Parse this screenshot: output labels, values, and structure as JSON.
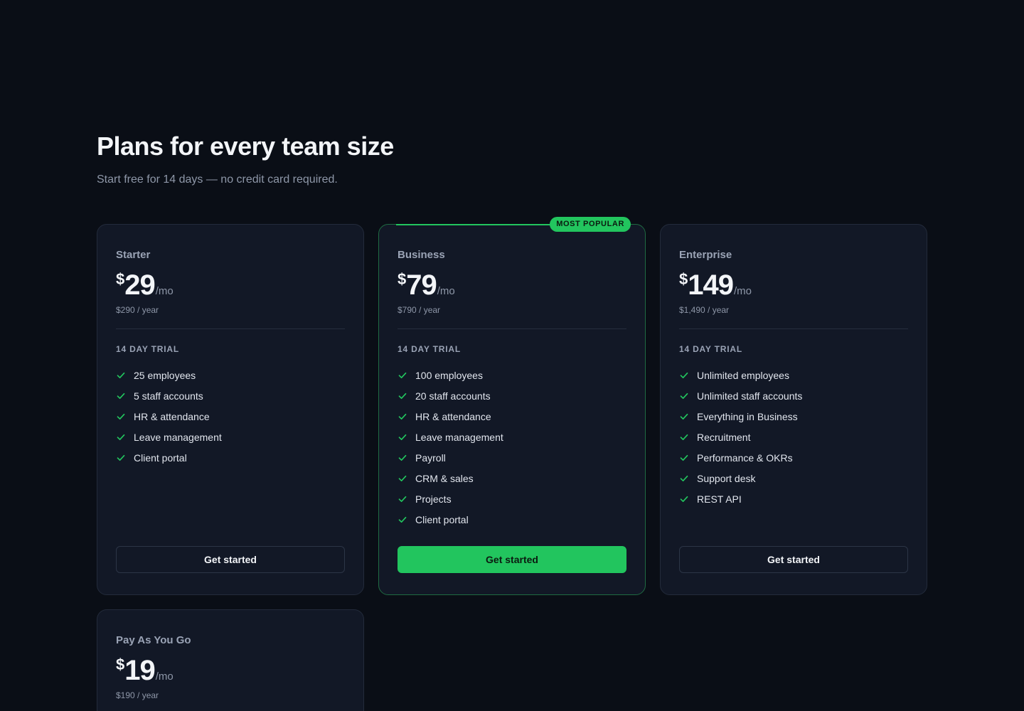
{
  "header": {
    "title": "Plans for every team size",
    "subtitle": "Start free for 14 days — no credit card required."
  },
  "colors": {
    "background": "#0a0e16",
    "card": "#121826",
    "accent": "#22c55e"
  },
  "plans": [
    {
      "name": "Starter",
      "currency": "$",
      "price": "29",
      "period": "/mo",
      "yearly": "$290 / year",
      "trial": "14 DAY TRIAL",
      "features": [
        "25 employees",
        "5 staff accounts",
        "HR & attendance",
        "Leave management",
        "Client portal"
      ],
      "cta": "Get started",
      "featured": false
    },
    {
      "name": "Business",
      "badge": "MOST POPULAR",
      "currency": "$",
      "price": "79",
      "period": "/mo",
      "yearly": "$790 / year",
      "trial": "14 DAY TRIAL",
      "features": [
        "100 employees",
        "20 staff accounts",
        "HR & attendance",
        "Leave management",
        "Payroll",
        "CRM & sales",
        "Projects",
        "Client portal"
      ],
      "cta": "Get started",
      "featured": true
    },
    {
      "name": "Enterprise",
      "currency": "$",
      "price": "149",
      "period": "/mo",
      "yearly": "$1,490 / year",
      "trial": "14 DAY TRIAL",
      "features": [
        "Unlimited employees",
        "Unlimited staff accounts",
        "Everything in Business",
        "Recruitment",
        "Performance & OKRs",
        "Support desk",
        "REST API"
      ],
      "cta": "Get started",
      "featured": false
    },
    {
      "name": "Pay As You Go",
      "currency": "$",
      "price": "19",
      "period": "/mo",
      "yearly": "$190 / year",
      "featured": false
    }
  ]
}
